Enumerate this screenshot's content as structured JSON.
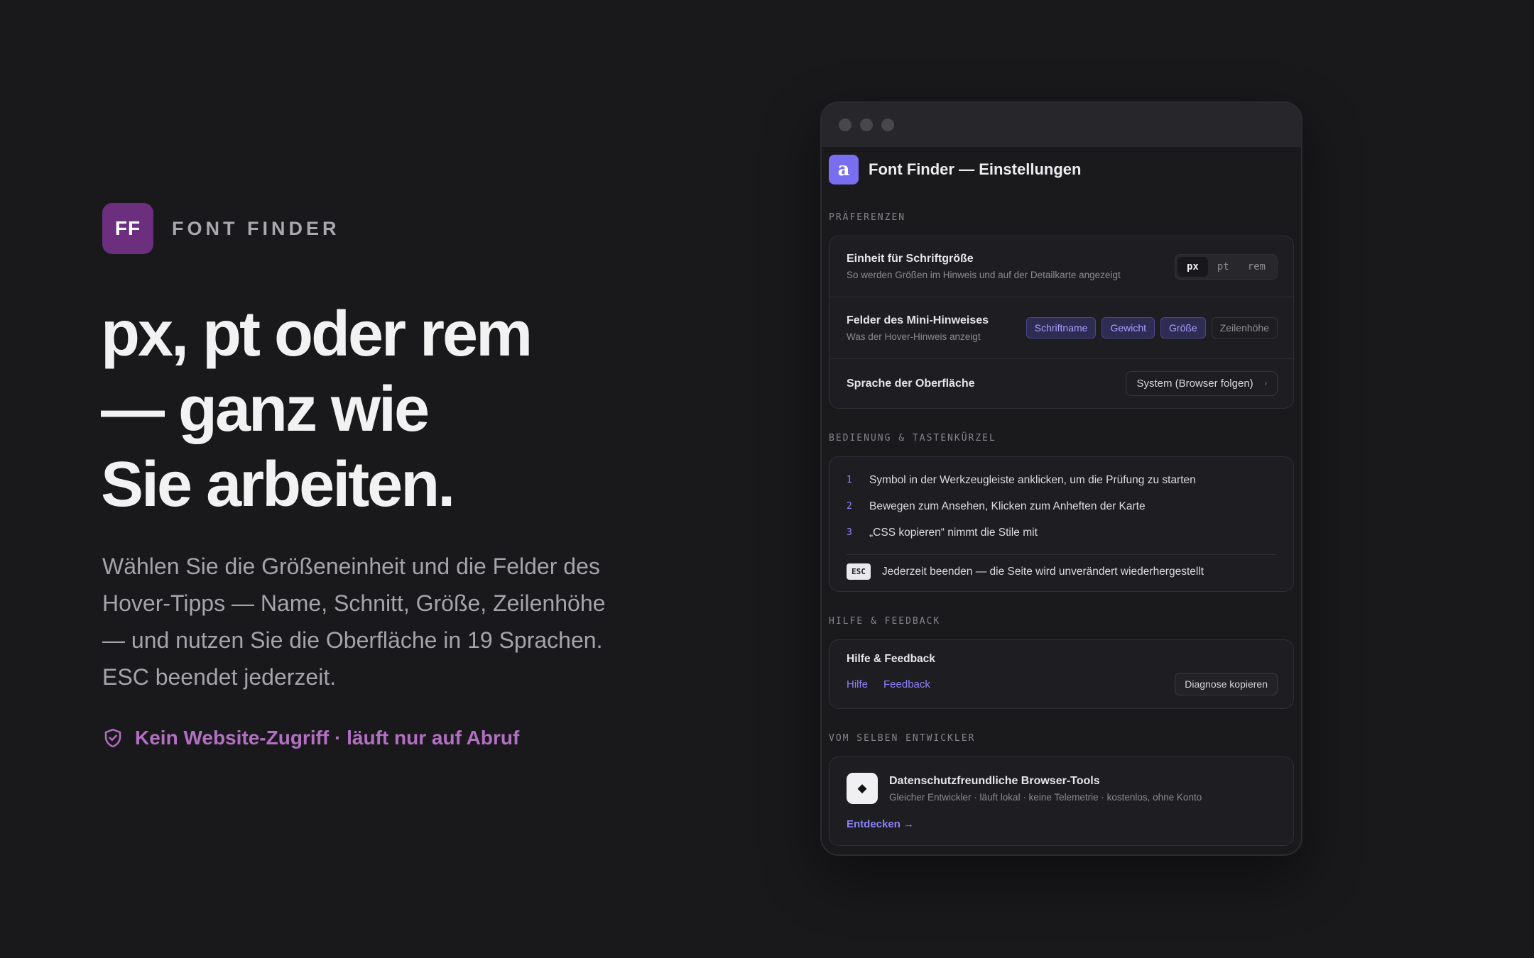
{
  "brand": {
    "logo_text": "FF",
    "name": "FONT FINDER"
  },
  "headline": {
    "line1": "px, pt oder rem",
    "line2": "— ganz wie",
    "line3": "Sie arbeiten."
  },
  "lede": {
    "line1": "Wählen Sie die Größeneinheit und die Felder des",
    "line2": "Hover-Tipps — Name, Schnitt, Größe, Zeilenhöhe",
    "line3": "— und nutzen Sie die Oberfläche in 19 Sprachen.",
    "line4": "ESC beendet jederzeit."
  },
  "privacy": {
    "icon": "shield-check-icon",
    "text": "Kein Website-Zugriff · läuft nur auf Abruf"
  },
  "window": {
    "app_icon": "a",
    "title": "Font Finder — Einstellungen",
    "preferences": {
      "section_label": "PRÄFERENZEN",
      "unit": {
        "title": "Einheit für Schriftgröße",
        "subtitle": "So werden Größen im Hinweis und auf der Detailkarte angezeigt",
        "options": [
          "px",
          "pt",
          "rem"
        ],
        "selected": "px"
      },
      "fields": {
        "title": "Felder des Mini-Hinweises",
        "subtitle": "Was der Hover-Hinweis anzeigt",
        "chips": [
          {
            "label": "Schriftname",
            "on": true
          },
          {
            "label": "Gewicht",
            "on": true
          },
          {
            "label": "Größe",
            "on": true
          },
          {
            "label": "Zeilenhöhe",
            "on": false
          }
        ]
      },
      "language": {
        "title": "Sprache der Oberfläche",
        "value": "System (Browser folgen)",
        "chevron": "›"
      }
    },
    "controls": {
      "section_label": "BEDIENUNG & TASTENKÜRZEL",
      "steps": [
        {
          "num": "1",
          "text": "Symbol in der Werkzeugleiste anklicken, um die Prüfung zu starten"
        },
        {
          "num": "2",
          "text": "Bewegen zum Ansehen, Klicken zum Anheften der Karte"
        },
        {
          "num": "3",
          "text": "„CSS kopieren“ nimmt die Stile mit"
        }
      ],
      "esc_key": "ESC",
      "esc_text": "Jederzeit beenden — die Seite wird unverändert wiederhergestellt"
    },
    "help": {
      "section_label": "HILFE & FEEDBACK",
      "title": "Hilfe & Feedback",
      "help_link": "Hilfe",
      "feedback_link": "Feedback",
      "diagnostics_button": "Diagnose kopieren"
    },
    "developer": {
      "section_label": "VOM SELBEN ENTWICKLER",
      "icon_glyph": "◆",
      "title": "Datenschutzfreundliche Browser-Tools",
      "subtitle": "Gleicher Entwickler · läuft lokal · keine Telemetrie · kostenlos, ohne Konto",
      "link": "Entdecken →"
    }
  },
  "colors": {
    "background": "#19191c",
    "brand": "#6b2f7e",
    "accent": "#8a82f8",
    "privacy": "#b36fc2"
  }
}
